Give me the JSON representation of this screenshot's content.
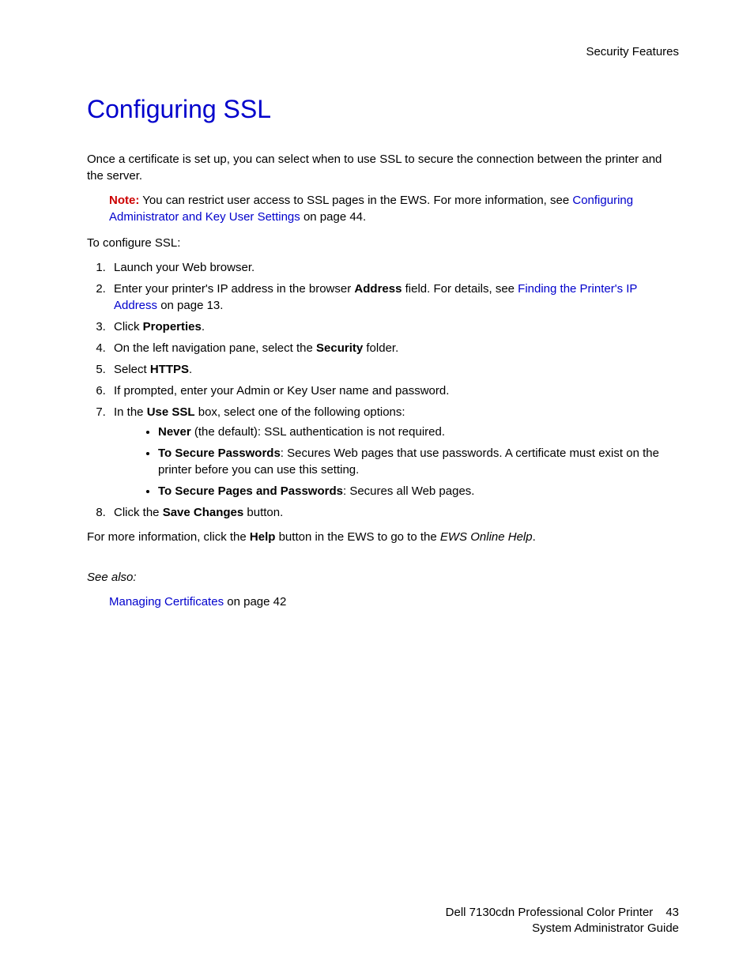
{
  "header": {
    "section": "Security Features"
  },
  "title": "Configuring SSL",
  "intro": "Once a certificate is set up, you can select when to use SSL to secure the connection between the printer and the server.",
  "note": {
    "label": "Note:",
    "text_before_link": " You can restrict user access to SSL pages in the EWS. For more information, see ",
    "link": "Configuring Administrator and Key User Settings",
    "text_after_link": " on page 44."
  },
  "lead": "To configure SSL:",
  "steps": {
    "s1": "Launch your Web browser.",
    "s2": {
      "pre": "Enter your printer's IP address in the browser ",
      "bold": "Address",
      "mid": " field. For details, see ",
      "link": "Finding the Printer's IP Address",
      "post": " on page 13."
    },
    "s3": {
      "pre": "Click ",
      "bold": "Properties",
      "post": "."
    },
    "s4": {
      "pre": "On the left navigation pane, select the ",
      "bold": "Security",
      "post": " folder."
    },
    "s5": {
      "pre": "Select ",
      "bold": "HTTPS",
      "post": "."
    },
    "s6": "If prompted, enter your Admin or Key User name and password.",
    "s7": {
      "pre": "In the ",
      "bold": "Use SSL",
      "post": " box, select one of the following options:"
    },
    "s8": {
      "pre": "Click the ",
      "bold": "Save Changes",
      "post": " button."
    }
  },
  "bullets": {
    "b1": {
      "bold": "Never",
      "post": " (the default): SSL authentication is not required."
    },
    "b2": {
      "bold": "To Secure Passwords",
      "post": ": Secures Web pages that use passwords. A certificate must exist on the printer before you can use this setting."
    },
    "b3": {
      "bold": "To Secure Pages and Passwords",
      "post": ": Secures all Web pages."
    }
  },
  "moreinfo": {
    "pre": "For more information, click the ",
    "bold": "Help",
    "mid": " button in the EWS to go to the ",
    "italic": "EWS Online Help",
    "post": "."
  },
  "seealso": {
    "label": "See also:",
    "link": "Managing Certificates",
    "post": " on page 42"
  },
  "footer": {
    "line1": "Dell 7130cdn Professional Color Printer",
    "line2": "System Administrator Guide",
    "page": "43"
  }
}
